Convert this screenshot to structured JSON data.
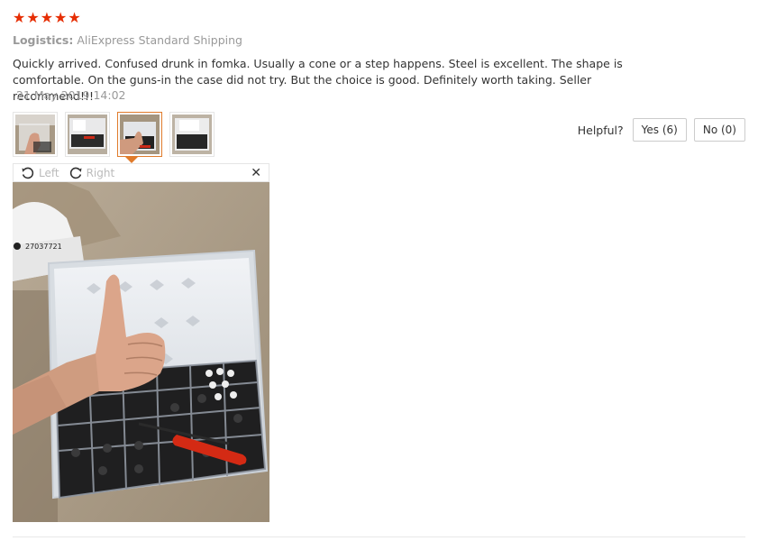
{
  "rating": {
    "stars": 5,
    "color": "#e62e04"
  },
  "logistics": {
    "label": "Logistics:",
    "value": "AliExpress Standard Shipping"
  },
  "review": {
    "text": "Quickly arrived. Confused drunk in fomka. Usually a cone or a step happens. Steel is excellent. The shape is comfortable. On the guns-in the case did not try. But the choice is good. Definitely worth taking. Seller recommend!!!",
    "date": "21 May 2019 14:02"
  },
  "thumbnails": {
    "count": 4,
    "active_index": 2
  },
  "viewer": {
    "rotate_left": "Left",
    "rotate_right": "Right",
    "close": "✕",
    "label_text": "27037721"
  },
  "helpful": {
    "question": "Helpful?",
    "yes": "Yes (6)",
    "no": "No (0)"
  },
  "colors": {
    "accent": "#e07b2b",
    "muted": "#999999"
  }
}
